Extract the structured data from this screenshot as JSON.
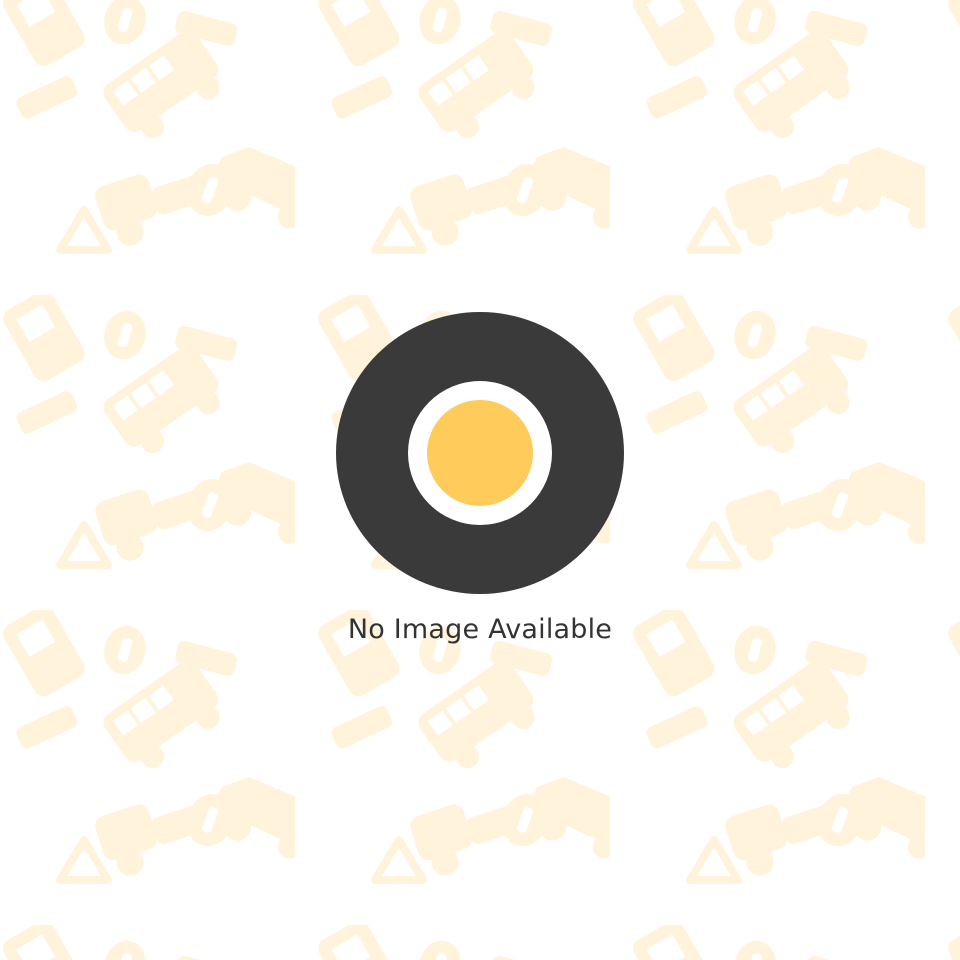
{
  "placeholder": {
    "caption": "No Image Available",
    "icon": "tire-icon",
    "background_icons": [
      "tow-truck-icon",
      "bus-icon",
      "car-icon",
      "warning-triangle-icon",
      "tire-icon",
      "battery-icon"
    ]
  },
  "colors": {
    "background": "#ffffff",
    "pattern": "#fff3dc",
    "tire_outer": "#3a3a3a",
    "tire_ring": "#ffffff",
    "tire_hub": "#ffcc5c",
    "caption_text": "#333333"
  }
}
